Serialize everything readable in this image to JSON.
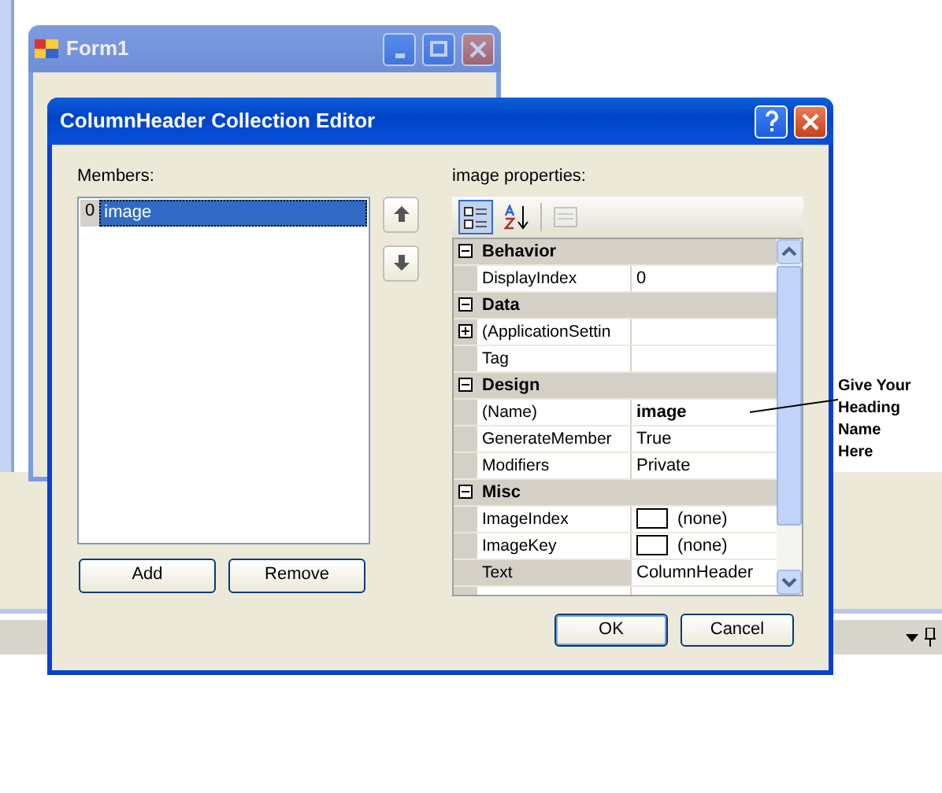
{
  "form_window": {
    "title": "Form1"
  },
  "dialog": {
    "title": "ColumnHeader Collection Editor",
    "members_label": "Members:",
    "members": [
      {
        "index": "0",
        "name": "image",
        "selected": true
      }
    ],
    "properties_label": "image properties:",
    "toolbar": [
      {
        "kind": "categorized",
        "selected": true,
        "disabled": false
      },
      {
        "kind": "alphabetical",
        "selected": false,
        "disabled": false
      },
      {
        "kind": "pages",
        "selected": false,
        "disabled": true
      }
    ],
    "categories": [
      {
        "name": "Behavior",
        "expanded": true,
        "properties": [
          {
            "name": "DisplayIndex",
            "value": "0",
            "kind": "text",
            "bold": false,
            "selected": false
          }
        ]
      },
      {
        "name": "Data",
        "expanded": true,
        "properties": [
          {
            "name": "(ApplicationSettin",
            "kind": "expandable",
            "selected": false
          },
          {
            "name": "Tag",
            "kind": "text",
            "selected": false
          }
        ]
      },
      {
        "name": "Design",
        "expanded": true,
        "properties": [
          {
            "name": "(Name)",
            "value": "image",
            "kind": "text",
            "bold": true,
            "selected": false
          },
          {
            "name": "GenerateMember",
            "value": "True",
            "kind": "text",
            "bold": false,
            "selected": false
          },
          {
            "name": "Modifiers",
            "value": "Private",
            "kind": "text",
            "bold": false,
            "selected": false
          }
        ]
      },
      {
        "name": "Misc",
        "expanded": true,
        "properties": [
          {
            "name": "ImageIndex",
            "value": "(none)",
            "kind": "image",
            "bold": false,
            "selected": false
          },
          {
            "name": "ImageKey",
            "value": "(none)",
            "kind": "image",
            "bold": false,
            "selected": false
          },
          {
            "name": "Text",
            "value": "ColumnHeader",
            "kind": "text",
            "bold": false,
            "selected": true
          }
        ]
      }
    ],
    "buttons": {
      "add": "Add",
      "remove": "Remove",
      "ok": "OK",
      "cancel": "Cancel"
    }
  },
  "annotation": {
    "lines": [
      "Give Your",
      "Heading",
      "Name",
      "Here"
    ]
  }
}
